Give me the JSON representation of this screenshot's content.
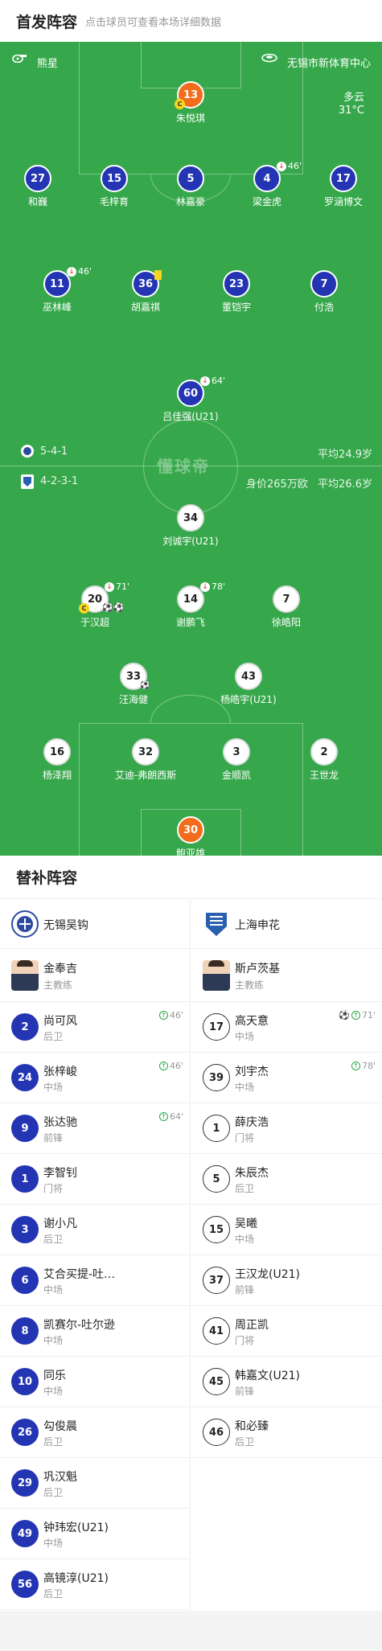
{
  "header": {
    "title": "首发阵容",
    "subtitle": "点击球员可查看本场详细数据"
  },
  "pitch": {
    "referee": "熊星",
    "venue": "无锡市新体育中心",
    "weather": "多云",
    "temperature": "31°C",
    "watermark": "懂球帝",
    "home": {
      "formation": "5-4-1",
      "avg_age": "平均24.9岁"
    },
    "away": {
      "formation": "4-2-3-1",
      "value": "身价265万欧",
      "avg_age": "平均26.6岁"
    }
  },
  "home_players": [
    {
      "num": "13",
      "name": "朱悦琪",
      "color": "orange",
      "cap": "C"
    },
    {
      "num": "27",
      "name": "和巍"
    },
    {
      "num": "15",
      "name": "毛梓育"
    },
    {
      "num": "5",
      "name": "林嘉豪"
    },
    {
      "num": "4",
      "name": "梁金虎",
      "sub": "46'"
    },
    {
      "num": "17",
      "name": "罗涵博文"
    },
    {
      "num": "11",
      "name": "巫林峰",
      "sub": "46'"
    },
    {
      "num": "36",
      "name": "胡嘉祺"
    },
    {
      "num": "23",
      "name": "董铠宇"
    },
    {
      "num": "7",
      "name": "付浩"
    },
    {
      "num": "60",
      "name": "吕佳强(U21)",
      "sub": "64'"
    }
  ],
  "away_players": [
    {
      "num": "34",
      "name": "刘诚宇(U21)"
    },
    {
      "num": "20",
      "name": "于汉超",
      "sub": "71'",
      "cap": "C"
    },
    {
      "num": "14",
      "name": "谢鹏飞",
      "sub": "78'"
    },
    {
      "num": "7",
      "name": "徐皓阳"
    },
    {
      "num": "33",
      "name": "汪海健"
    },
    {
      "num": "43",
      "name": "杨皓宇(U21)"
    },
    {
      "num": "16",
      "name": "杨泽翔"
    },
    {
      "num": "32",
      "name": "艾迪-弗朗西斯"
    },
    {
      "num": "3",
      "name": "金顺凯"
    },
    {
      "num": "2",
      "name": "王世龙"
    },
    {
      "num": "30",
      "name": "鲍亚雄",
      "color": "orange"
    }
  ],
  "subs": {
    "title": "替补阵容",
    "home": {
      "team": "无锡吴钩",
      "coach": {
        "name": "金奉吉",
        "role": "主教练"
      },
      "players": [
        {
          "num": "2",
          "name": "尚可风",
          "pos": "后卫",
          "ex": "46'"
        },
        {
          "num": "24",
          "name": "张梓峻",
          "pos": "中场",
          "ex": "46'"
        },
        {
          "num": "9",
          "name": "张达驰",
          "pos": "前锋",
          "ex": "64'"
        },
        {
          "num": "1",
          "name": "李智钊",
          "pos": "门将"
        },
        {
          "num": "3",
          "name": "谢小凡",
          "pos": "后卫"
        },
        {
          "num": "6",
          "name": "艾合买提-吐…",
          "pos": "中场"
        },
        {
          "num": "8",
          "name": "凯赛尔-吐尔逊",
          "pos": "中场"
        },
        {
          "num": "10",
          "name": "同乐",
          "pos": "中场"
        },
        {
          "num": "26",
          "name": "勾俊晨",
          "pos": "后卫"
        },
        {
          "num": "29",
          "name": "巩汉魁",
          "pos": "后卫"
        },
        {
          "num": "49",
          "name": "钟玮宏(U21)",
          "pos": "中场"
        },
        {
          "num": "56",
          "name": "高镜淳(U21)",
          "pos": "后卫"
        }
      ]
    },
    "away": {
      "team": "上海申花",
      "coach": {
        "name": "斯卢茨基",
        "role": "主教练"
      },
      "players": [
        {
          "num": "17",
          "name": "高天意",
          "pos": "中场",
          "ex": "71'",
          "goal": true
        },
        {
          "num": "39",
          "name": "刘宇杰",
          "pos": "中场",
          "ex": "78'"
        },
        {
          "num": "1",
          "name": "薛庆浩",
          "pos": "门将"
        },
        {
          "num": "5",
          "name": "朱辰杰",
          "pos": "后卫"
        },
        {
          "num": "15",
          "name": "吴曦",
          "pos": "中场"
        },
        {
          "num": "37",
          "name": "王汉龙(U21)",
          "pos": "前锋"
        },
        {
          "num": "41",
          "name": "周正凯",
          "pos": "门将"
        },
        {
          "num": "45",
          "name": "韩嘉文(U21)",
          "pos": "前锋"
        },
        {
          "num": "46",
          "name": "和必臻",
          "pos": "后卫"
        }
      ]
    }
  }
}
